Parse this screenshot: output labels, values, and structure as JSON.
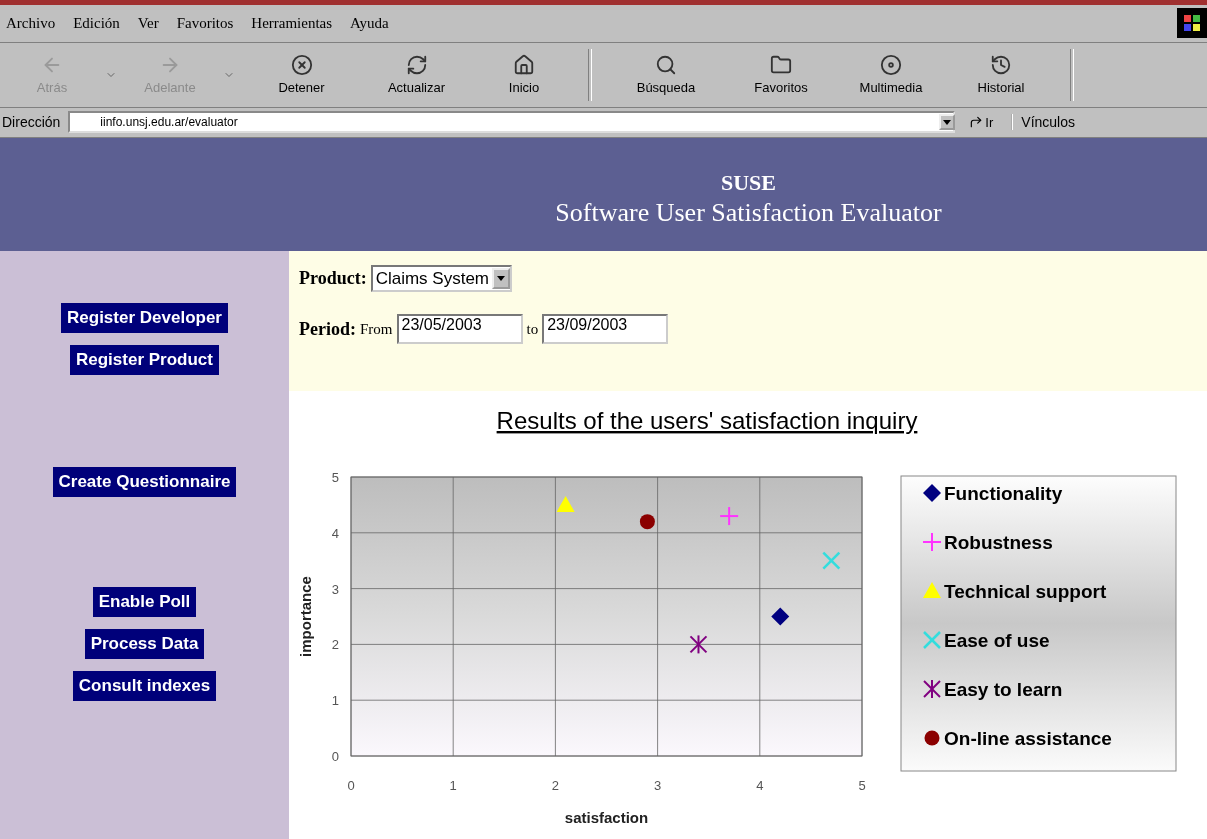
{
  "menu": [
    "Archivo",
    "Edición",
    "Ver",
    "Favoritos",
    "Herramientas",
    "Ayuda"
  ],
  "toolbar": [
    {
      "label": "Atrás",
      "kind": "back",
      "disabled": true,
      "dropdown": true
    },
    {
      "label": "Adelante",
      "kind": "forward",
      "disabled": true,
      "dropdown": true
    },
    {
      "label": "Detener",
      "kind": "stop",
      "disabled": false,
      "dropdown": false
    },
    {
      "label": "Actualizar",
      "kind": "refresh",
      "disabled": false,
      "dropdown": false
    },
    {
      "label": "Inicio",
      "kind": "home",
      "disabled": false,
      "dropdown": false
    },
    {
      "label": "Búsqueda",
      "kind": "search",
      "disabled": false,
      "dropdown": false
    },
    {
      "label": "Favoritos",
      "kind": "folder",
      "disabled": false,
      "dropdown": false
    },
    {
      "label": "Multimedia",
      "kind": "media",
      "disabled": false,
      "dropdown": false
    },
    {
      "label": "Historial",
      "kind": "history",
      "disabled": false,
      "dropdown": false
    }
  ],
  "address_bar": {
    "label": "Dirección",
    "value": "iinfo.unsj.edu.ar/evaluator",
    "go": "Ir",
    "links": "Vínculos"
  },
  "header": {
    "title": "SUSE",
    "subtitle": "Software User Satisfaction Evaluator"
  },
  "sidebar": {
    "groups": [
      [
        "Register Developer",
        "Register Product"
      ],
      [
        "Create Questionnaire"
      ],
      [
        "Enable Poll",
        "Process Data",
        "Consult indexes"
      ]
    ]
  },
  "form": {
    "product_label": "Product:",
    "product": "Claims System",
    "period_label": "Period:",
    "from_label": "From",
    "from": "23/05/2003",
    "to_label": "to",
    "to": "23/09/2003"
  },
  "chart": {
    "chart_data": {
      "type": "scatter",
      "title": "Results of the users' satisfaction inquiry",
      "xlabel": "satisfaction",
      "ylabel": "importance",
      "xlim": [
        0,
        5
      ],
      "ylim": [
        0,
        5
      ],
      "xticks": [
        0,
        1,
        2,
        3,
        4,
        5
      ],
      "yticks": [
        0,
        1,
        2,
        3,
        4,
        5
      ],
      "grid": true,
      "legend": true,
      "series": [
        {
          "name": "Functionality",
          "color": "#000080",
          "marker": "diamond",
          "x": [
            4.2
          ],
          "values": [
            2.5
          ]
        },
        {
          "name": "Robustness",
          "color": "#ff33ff",
          "marker": "plus",
          "x": [
            3.7
          ],
          "values": [
            4.3
          ]
        },
        {
          "name": "Technical support",
          "color": "#ffff00",
          "marker": "triangle",
          "x": [
            2.1
          ],
          "values": [
            4.5
          ]
        },
        {
          "name": "Ease of use",
          "color": "#33dddd",
          "marker": "cross",
          "x": [
            4.7
          ],
          "values": [
            3.5
          ]
        },
        {
          "name": "Easy to learn",
          "color": "#800080",
          "x": [
            3.4
          ],
          "values": [
            2.0
          ]
        },
        {
          "name": "On-line assistance",
          "color": "#8b0000",
          "marker": "circle",
          "x": [
            2.9
          ],
          "values": [
            4.2
          ]
        }
      ]
    }
  }
}
